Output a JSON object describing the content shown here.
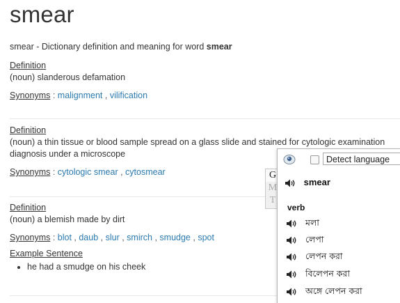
{
  "page": {
    "title": "smear",
    "subtitle_prefix": "smear - Dictionary definition and meaning for word ",
    "subtitle_word": "smear"
  },
  "entries": [
    {
      "definition_label": "Definition",
      "definition_text": "(noun) slanderous defamation",
      "synonyms_label": "Synonyms",
      "synonyms": [
        "malignment",
        "vilification"
      ]
    },
    {
      "definition_label": "Definition",
      "definition_text": "(noun) a thin tissue or blood sample spread on a glass slide and stained for cytologic examination",
      "definition_text_2": "diagnosis under a microscope",
      "synonyms_label": "Synonyms",
      "synonyms": [
        "cytologic smear",
        "cytosmear"
      ]
    },
    {
      "definition_label": "Definition",
      "definition_text": "(noun) a blemish made by dirt",
      "synonyms_label": "Synonyms",
      "synonyms": [
        "blot",
        "daub",
        "slur",
        "smirch",
        "smudge",
        "spot"
      ],
      "example_label": "Example Sentence",
      "example": "he had a smudge on his cheek"
    }
  ],
  "popup": {
    "detect_label": "Detect language",
    "gmt_letters": [
      "G",
      "M",
      "T"
    ],
    "word": "smear",
    "part_of_speech": "verb",
    "translations": [
      "মলা",
      "লেপা",
      "লেপন করা",
      "বিলেপন করা",
      "অঙ্গে লেপন করা"
    ],
    "icons": [
      "translator-logo-icon",
      "speaker-icon"
    ]
  },
  "colors": {
    "link": "#2a7ab0",
    "text": "#333333"
  }
}
